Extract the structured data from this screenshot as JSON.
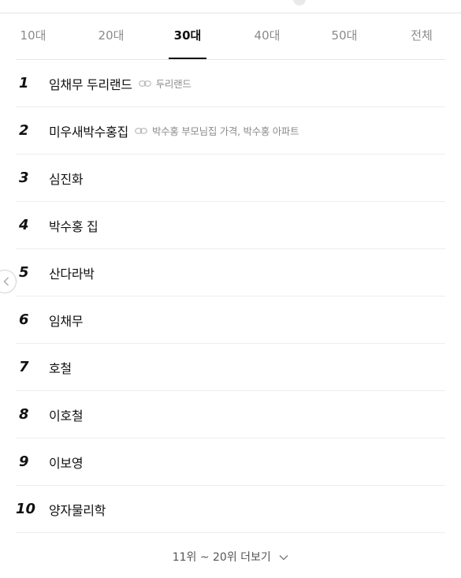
{
  "tabs": [
    {
      "label": "10대",
      "active": false
    },
    {
      "label": "20대",
      "active": false
    },
    {
      "label": "30대",
      "active": true
    },
    {
      "label": "40대",
      "active": false
    },
    {
      "label": "50대",
      "active": false
    },
    {
      "label": "전체",
      "active": false
    }
  ],
  "rankings": [
    {
      "rank": "1",
      "keyword": "임채무 두리랜드",
      "related": "두리랜드"
    },
    {
      "rank": "2",
      "keyword": "미우새박수홍집",
      "related": "박수홍 부모님집 가격, 박수홍 아파트"
    },
    {
      "rank": "3",
      "keyword": "심진화",
      "related": ""
    },
    {
      "rank": "4",
      "keyword": "박수홍 집",
      "related": ""
    },
    {
      "rank": "5",
      "keyword": "산다라박",
      "related": ""
    },
    {
      "rank": "6",
      "keyword": "임채무",
      "related": ""
    },
    {
      "rank": "7",
      "keyword": "호철",
      "related": ""
    },
    {
      "rank": "8",
      "keyword": "이호철",
      "related": ""
    },
    {
      "rank": "9",
      "keyword": "이보영",
      "related": ""
    },
    {
      "rank": "10",
      "keyword": "양자물리학",
      "related": ""
    }
  ],
  "more": {
    "label": "11위 ~ 20위 더보기"
  },
  "icons": {
    "link": "link-icon",
    "more": "chevron-down-icon",
    "side": "chevron-left-icon"
  }
}
